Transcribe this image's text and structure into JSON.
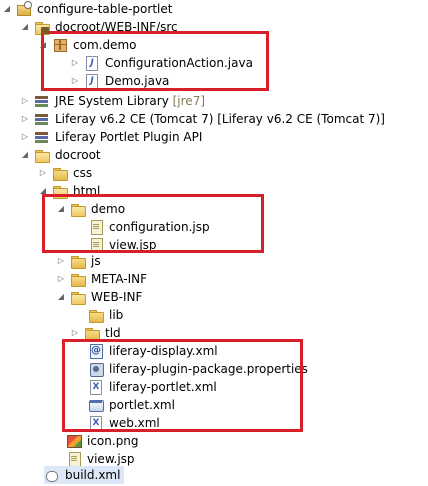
{
  "tree": {
    "project": "configure-table-portlet",
    "src_folder": "docroot/WEB-INF/src",
    "package": "com.demo",
    "java_files": [
      "ConfigurationAction.java",
      "Demo.java"
    ],
    "libraries": {
      "jre": "JRE System Library",
      "jre_suffix": "[jre7]",
      "liferay_ce": "Liferay v6.2 CE (Tomcat 7) [Liferay v6.2 CE (Tomcat 7)]",
      "plugin_api": "Liferay Portlet Plugin API"
    },
    "docroot": "docroot",
    "css": "css",
    "html": "html",
    "demo": "demo",
    "demo_files": [
      "configuration.jsp",
      "view.jsp"
    ],
    "js": "js",
    "meta_inf": "META-INF",
    "web_inf": "WEB-INF",
    "lib": "lib",
    "tld": "tld",
    "web_inf_files": [
      "liferay-display.xml",
      "liferay-plugin-package.properties",
      "liferay-portlet.xml",
      "portlet.xml",
      "web.xml"
    ],
    "icon_png": "icon.png",
    "view_jsp": "view.jsp",
    "build_xml": "build.xml"
  },
  "icons": [
    "project-icon",
    "source-folder-icon",
    "package-icon",
    "java-file-icon",
    "library-icon",
    "folder-icon",
    "jsp-file-icon",
    "xml-file-icon",
    "properties-file-icon",
    "portlet-xml-icon",
    "image-icon",
    "ant-build-icon"
  ],
  "highlight_color": "#d9202a"
}
